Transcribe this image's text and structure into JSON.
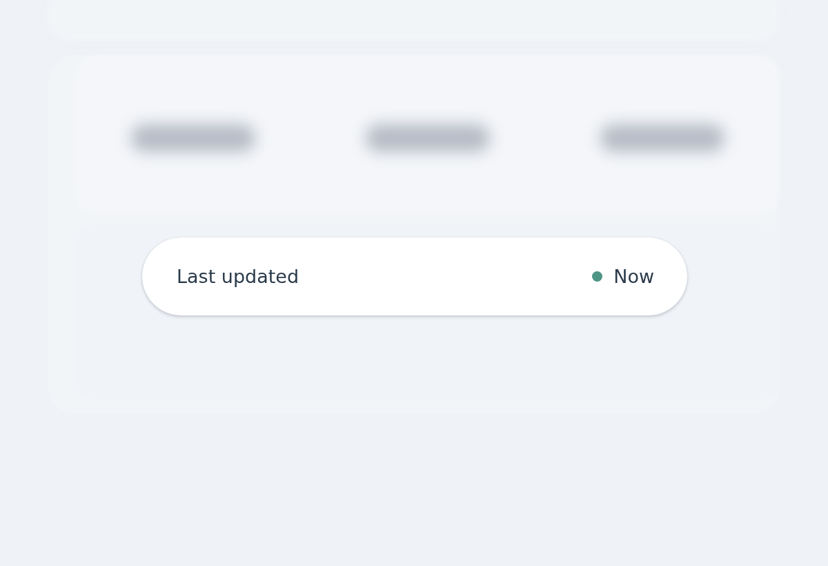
{
  "status_card": {
    "label": "Last updated",
    "status": {
      "text": "Now",
      "color": "#4e9585"
    }
  }
}
